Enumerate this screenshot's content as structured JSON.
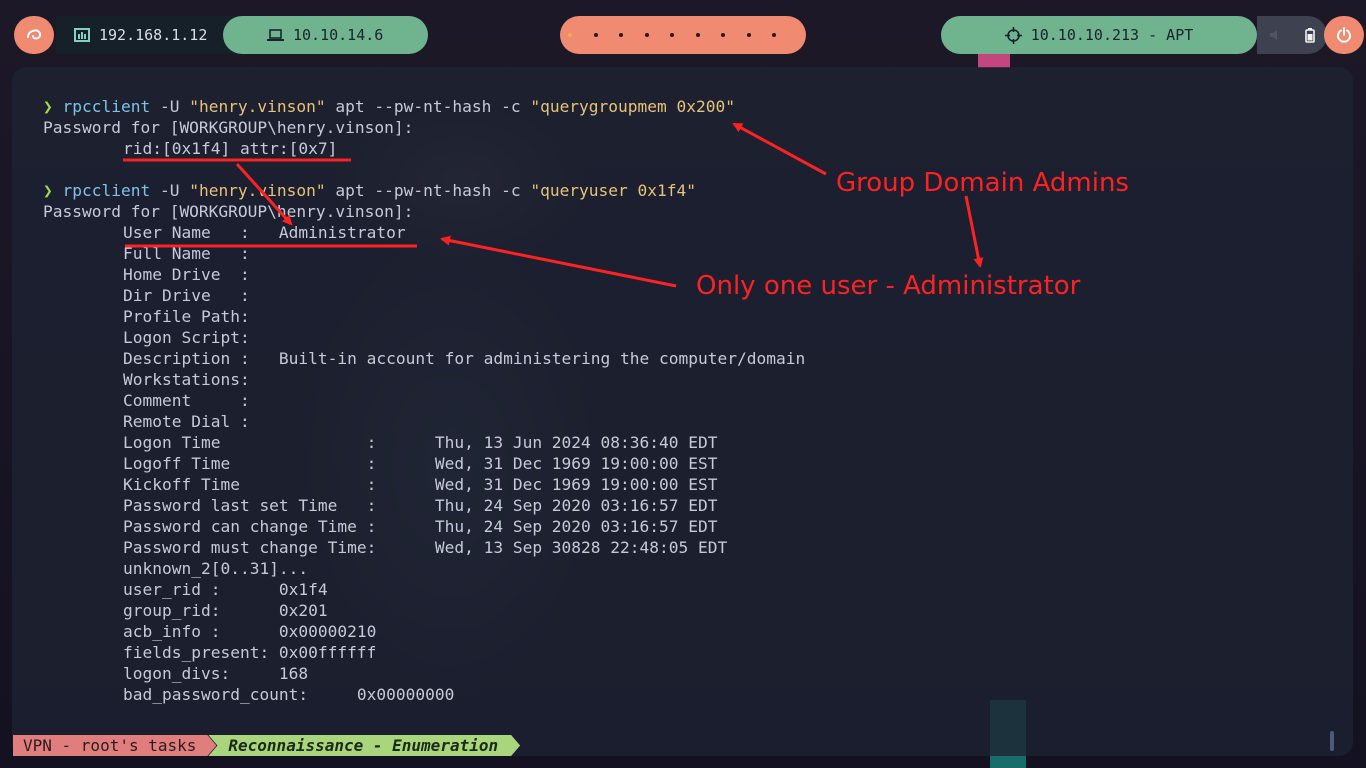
{
  "topbar": {
    "ip_local": "192.168.1.12",
    "ip_vpn": "10.10.14.6",
    "target": "10.10.10.213 - APT",
    "workspaces": 9,
    "icons": [
      "debian-swirl-icon",
      "network-icon",
      "laptop-icon",
      "crosshair-icon",
      "volume-icon",
      "battery-icon",
      "power-icon"
    ]
  },
  "terminal": {
    "lines": [
      {
        "type": "prompt",
        "prompt": "❯ ",
        "cmd": "rpcclient",
        "args": " -U ",
        "s1": "\"henry.vinson\"",
        "args2": " apt --pw-nt-hash -c ",
        "s2": "\"querygroupmem 0x200\""
      },
      {
        "type": "text",
        "text": "Password for [WORKGROUP\\henry.vinson]:"
      },
      {
        "type": "cont",
        "text": "rid:[0x1f4] attr:[0x7]"
      },
      {
        "type": "blank",
        "text": ""
      },
      {
        "type": "prompt",
        "prompt": "❯ ",
        "cmd": "rpcclient",
        "args": " -U ",
        "s1": "\"henry.vinson\"",
        "args2": " apt --pw-nt-hash -c ",
        "s2": "\"queryuser 0x1f4\""
      },
      {
        "type": "text",
        "text": "Password for [WORKGROUP\\henry.vinson]:"
      },
      {
        "type": "cont",
        "text": "User Name   :   Administrator"
      },
      {
        "type": "cont",
        "text": "Full Name   :"
      },
      {
        "type": "cont",
        "text": "Home Drive  :"
      },
      {
        "type": "cont",
        "text": "Dir Drive   :"
      },
      {
        "type": "cont",
        "text": "Profile Path:"
      },
      {
        "type": "cont",
        "text": "Logon Script:"
      },
      {
        "type": "cont",
        "text": "Description :   Built-in account for administering the computer/domain"
      },
      {
        "type": "cont",
        "text": "Workstations:"
      },
      {
        "type": "cont",
        "text": "Comment     :"
      },
      {
        "type": "cont",
        "text": "Remote Dial :"
      },
      {
        "type": "cont",
        "text": "Logon Time               :      Thu, 13 Jun 2024 08:36:40 EDT"
      },
      {
        "type": "cont",
        "text": "Logoff Time              :      Wed, 31 Dec 1969 19:00:00 EST"
      },
      {
        "type": "cont",
        "text": "Kickoff Time             :      Wed, 31 Dec 1969 19:00:00 EST"
      },
      {
        "type": "cont",
        "text": "Password last set Time   :      Thu, 24 Sep 2020 03:16:57 EDT"
      },
      {
        "type": "cont",
        "text": "Password can change Time :      Thu, 24 Sep 2020 03:16:57 EDT"
      },
      {
        "type": "cont",
        "text": "Password must change Time:      Wed, 13 Sep 30828 22:48:05 EDT"
      },
      {
        "type": "cont",
        "text": "unknown_2[0..31]..."
      },
      {
        "type": "cont",
        "text": "user_rid :      0x1f4"
      },
      {
        "type": "cont",
        "text": "group_rid:      0x201"
      },
      {
        "type": "cont",
        "text": "acb_info :      0x00000210"
      },
      {
        "type": "cont",
        "text": "fields_present: 0x00ffffff"
      },
      {
        "type": "cont",
        "text": "logon_divs:     168"
      },
      {
        "type": "cont",
        "text": "bad_password_count:     0x00000000"
      }
    ]
  },
  "annotations": {
    "group": "Group Domain Admins",
    "user": "Only one user - Administrator",
    "color": "#ff2222"
  },
  "statusline": {
    "tasks": "VPN - root's tasks",
    "phase": "Reconnaissance - Enumeration"
  }
}
